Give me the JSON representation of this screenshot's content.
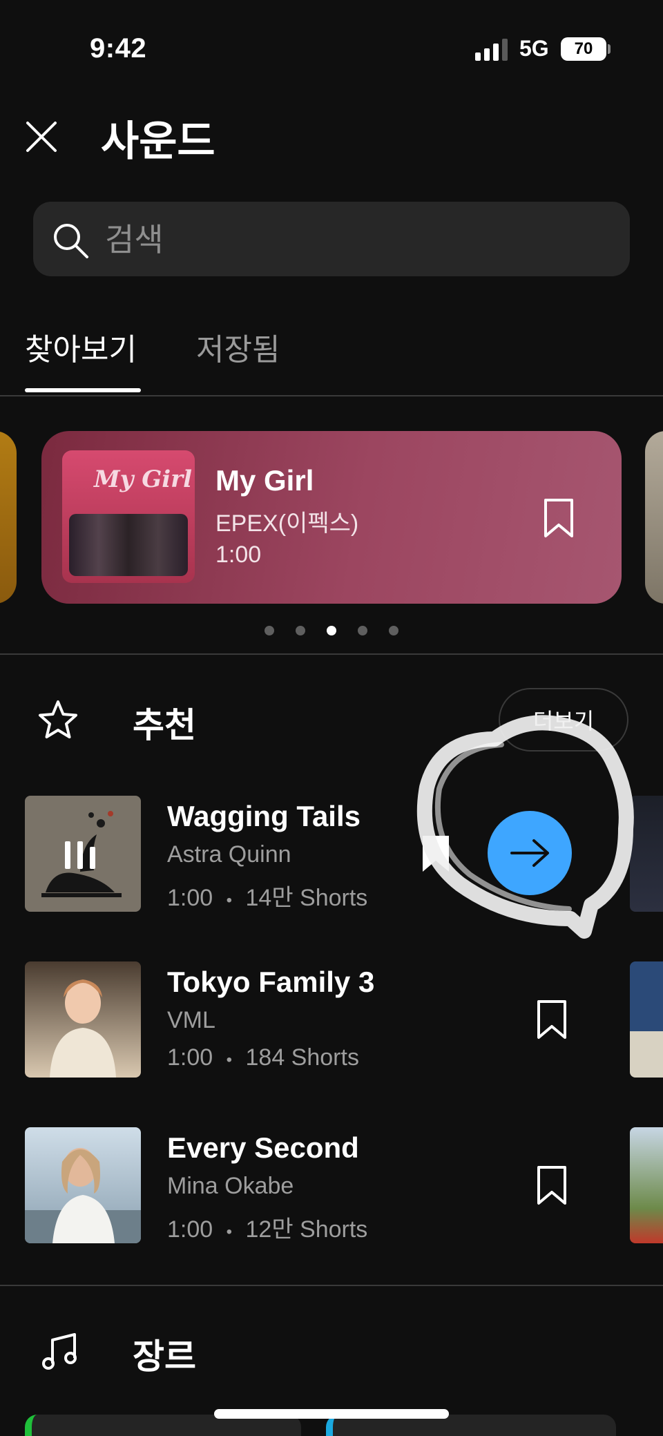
{
  "status_bar": {
    "time": "9:42",
    "network": "5G",
    "battery": "70"
  },
  "header": {
    "title": "사운드"
  },
  "search": {
    "placeholder": "검색"
  },
  "tabs": [
    {
      "label": "찾아보기",
      "active": true
    },
    {
      "label": "저장됨",
      "active": false
    }
  ],
  "featured": {
    "art_text": "My Girl",
    "title": "My Girl",
    "artist": "EPEX(이펙스)",
    "duration": "1:00",
    "page_index": 3,
    "page_count": 5
  },
  "recommend": {
    "title": "추천",
    "more_label": "더보기",
    "tracks": [
      {
        "title": "Wagging Tails",
        "artist": "Astra Quinn",
        "duration": "1:00",
        "shorts": "14만 Shorts",
        "playing": true
      },
      {
        "title": "Tokyo Family 3",
        "artist": "VML",
        "duration": "1:00",
        "shorts": "184 Shorts",
        "playing": false
      },
      {
        "title": "Every Second",
        "artist": "Mina Okabe",
        "duration": "1:00",
        "shorts": "12만 Shorts",
        "playing": false
      }
    ]
  },
  "genre": {
    "title": "장르"
  },
  "meta_separator": "•",
  "colors": {
    "accent_blue": "#3ea6ff",
    "background": "#0f0f0f",
    "featured_card": "#9c4660"
  },
  "icons": [
    "close-icon",
    "search-icon",
    "bookmark-icon",
    "star-icon",
    "music-note-icon",
    "pause-icon",
    "arrow-right-icon"
  ]
}
